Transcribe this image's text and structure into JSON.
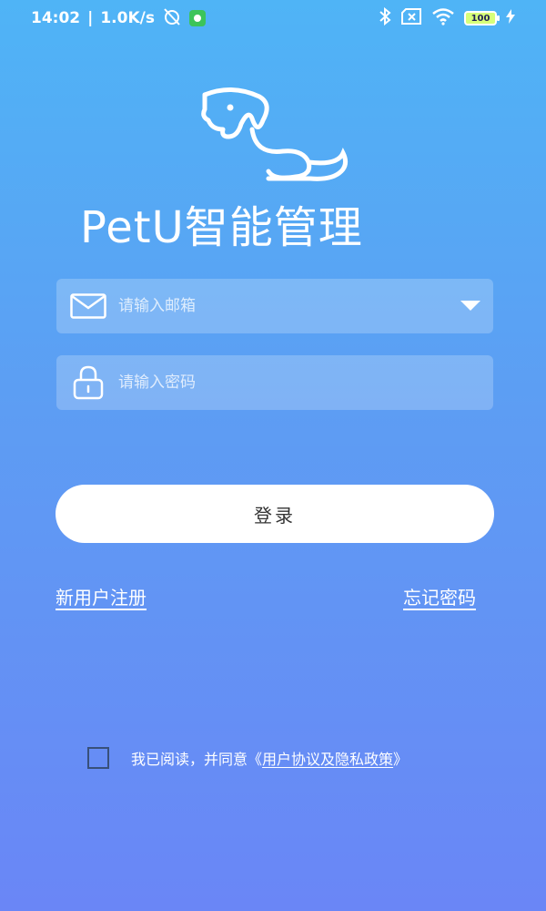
{
  "status_bar": {
    "time": "14:02",
    "speed": "1.0K/s",
    "battery": "100",
    "icons": [
      "alarm-off-icon",
      "app-notification-icon",
      "bluetooth-icon",
      "no-sim-icon",
      "wifi-icon",
      "battery-icon",
      "charging-icon"
    ]
  },
  "app": {
    "title": "PetU智能管理"
  },
  "email_field": {
    "placeholder": "请输入邮箱",
    "icon": "email-icon"
  },
  "password_field": {
    "placeholder": "请输入密码",
    "icon": "lock-icon"
  },
  "login_button": {
    "label": "登录"
  },
  "links": {
    "register": "新用户注册",
    "forgot_password": "忘记密码"
  },
  "agreement": {
    "prefix": "我已阅读，并同意",
    "open_quote": "《",
    "link_text": "用户协议及隐私政策",
    "close_quote": "》"
  },
  "colors": {
    "background_top": "#4fb4f6",
    "background_bottom": "#6a86f6",
    "button_bg": "#ffffff",
    "button_text": "#333333"
  }
}
